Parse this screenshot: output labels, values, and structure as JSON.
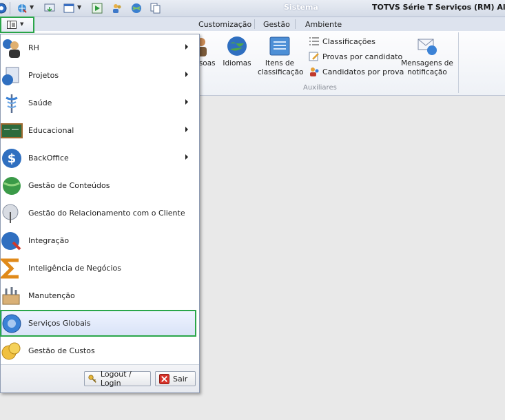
{
  "window": {
    "app_title": "Sistema",
    "title": "TOTVS Série T Serviços (RM) Alias:"
  },
  "quick_access": {
    "icons": [
      "app-orb-icon",
      "globe-arrow-icon",
      "monitor-arrow-icon",
      "window-icon",
      "run-icon",
      "users-icon",
      "web-globe-icon",
      "copy-pages-icon"
    ]
  },
  "ribbon": {
    "tabs": [
      "Customização",
      "Gestão",
      "Ambiente"
    ],
    "buttons": {
      "pessoas": "ssoas",
      "idiomas": "Idiomas",
      "itens_line1": "Itens de",
      "itens_line2": "classificação",
      "mensagens_line1": "Mensagens de",
      "mensagens_line2": "notificação"
    },
    "small_buttons": [
      "Classificações",
      "Provas por candidato",
      "Candidatos por prova"
    ],
    "group_label": "Auxiliares"
  },
  "app_menu": {
    "items": [
      {
        "label": "RH",
        "icon": "rh-people-icon",
        "submenu": true
      },
      {
        "label": "Projetos",
        "icon": "projects-icon",
        "submenu": true
      },
      {
        "label": "Saúde",
        "icon": "caduceus-icon",
        "submenu": true
      },
      {
        "label": "Educacional",
        "icon": "chalkboard-icon",
        "submenu": true
      },
      {
        "label": "BackOffice",
        "icon": "dollar-icon",
        "submenu": true
      },
      {
        "label": "Gestão de Conteúdos",
        "icon": "content-globe-icon",
        "submenu": false
      },
      {
        "label": "Gestão do Relacionamento com o Cliente",
        "icon": "crm-icon",
        "submenu": false
      },
      {
        "label": "Integração",
        "icon": "integration-globe-icon",
        "submenu": false
      },
      {
        "label": "Inteligência de Negócios",
        "icon": "sigma-icon",
        "submenu": false
      },
      {
        "label": "Manutenção",
        "icon": "toolbox-icon",
        "submenu": false
      },
      {
        "label": "Serviços Globais",
        "icon": "global-services-icon",
        "submenu": false
      },
      {
        "label": "Gestão de Custos",
        "icon": "coins-icon",
        "submenu": false
      }
    ],
    "logout_label": "Logout / Login",
    "exit_label": "Sair"
  },
  "colors": {
    "highlight_box": "#2aa64a",
    "menu_highlight": "#d9e3f7"
  }
}
